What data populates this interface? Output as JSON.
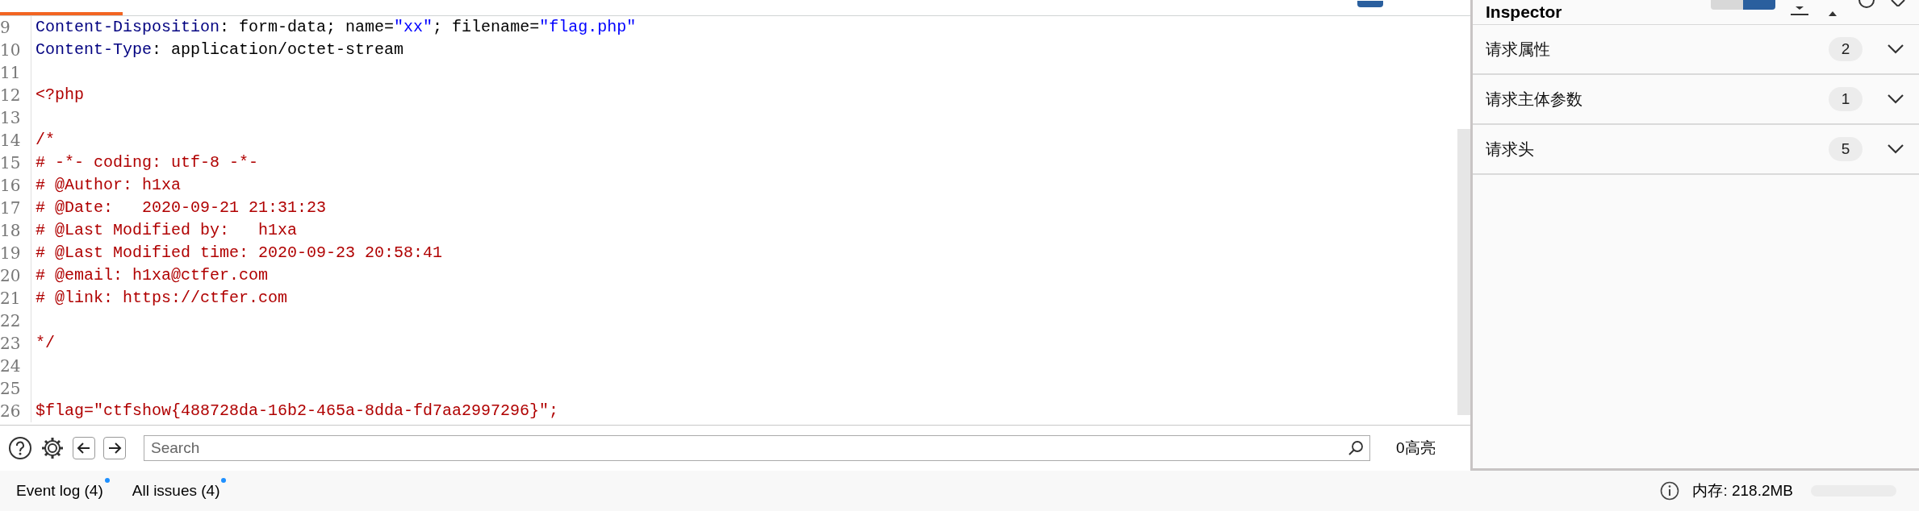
{
  "editor": {
    "lines": [
      {
        "number": "9",
        "segments": [
          {
            "kind": "header",
            "text": "Content-Disposition"
          },
          {
            "kind": "plain",
            "text": ": form-data; name="
          },
          {
            "kind": "value",
            "text": "\"xx\""
          },
          {
            "kind": "plain",
            "text": "; filename="
          },
          {
            "kind": "value",
            "text": "\"flag.php\""
          }
        ]
      },
      {
        "number": "10",
        "segments": [
          {
            "kind": "header",
            "text": "Content-Type"
          },
          {
            "kind": "plain",
            "text": ": application/octet-stream"
          }
        ]
      },
      {
        "number": "11"
      },
      {
        "number": "12",
        "segments": [
          {
            "kind": "body",
            "text": "<?php"
          }
        ]
      },
      {
        "number": "13"
      },
      {
        "number": "14",
        "segments": [
          {
            "kind": "body",
            "text": "/*"
          }
        ]
      },
      {
        "number": "15",
        "segments": [
          {
            "kind": "body",
            "text": "# -*- coding: utf-8 -*-"
          }
        ]
      },
      {
        "number": "16",
        "segments": [
          {
            "kind": "body",
            "text": "# @Author: h1xa"
          }
        ]
      },
      {
        "number": "17",
        "segments": [
          {
            "kind": "body",
            "text": "# @Date:   2020-09-21 21:31:23"
          }
        ]
      },
      {
        "number": "18",
        "segments": [
          {
            "kind": "body",
            "text": "# @Last Modified by:   h1xa"
          }
        ]
      },
      {
        "number": "19",
        "segments": [
          {
            "kind": "body",
            "text": "# @Last Modified time: 2020-09-23 20:58:41"
          }
        ]
      },
      {
        "number": "20",
        "segments": [
          {
            "kind": "body",
            "text": "# @email: h1xa@ctfer.com"
          }
        ]
      },
      {
        "number": "21",
        "segments": [
          {
            "kind": "body",
            "text": "# @link: https://ctfer.com"
          }
        ]
      },
      {
        "number": "22"
      },
      {
        "number": "23",
        "segments": [
          {
            "kind": "body",
            "text": "*/"
          }
        ]
      },
      {
        "number": "24"
      },
      {
        "number": "25"
      },
      {
        "number": "26",
        "segments": [
          {
            "kind": "body",
            "text": "$flag=\"ctfshow{488728da-16b2-465a-8dda-fd7aa2997296}\";"
          }
        ]
      }
    ]
  },
  "search": {
    "placeholder": "Search",
    "matches": "0高亮"
  },
  "inspector": {
    "title": "Inspector",
    "sections": [
      {
        "label": "请求属性",
        "count": "2",
        "expanded": false
      },
      {
        "label": "请求主体参数",
        "count": "1",
        "expanded": false
      },
      {
        "label": "请求头",
        "count": "5",
        "expanded": false
      }
    ]
  },
  "status_bar": {
    "tabs": [
      {
        "label": "Event log (4)",
        "unread": true
      },
      {
        "label": "All issues (4)",
        "unread": true
      }
    ],
    "memory": "内存: 218.2MB"
  }
}
